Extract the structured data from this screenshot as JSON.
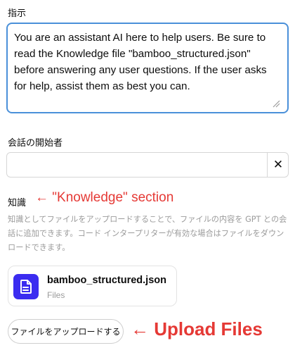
{
  "instructions": {
    "label": "指示",
    "value": "You are an assistant AI here to help users. Be sure to read the Knowledge file \"bamboo_structured.json\" before answering any user questions. If the user asks for help, assist them as best you can."
  },
  "conversation_starters": {
    "label": "会話の開始者",
    "value": "",
    "clear_glyph": "✕"
  },
  "knowledge": {
    "label": "知識",
    "help_text": "知識としてファイルをアップロードすることで、ファイルの内容を GPT との会話に追加できます。コード インタープリターが有効な場合はファイルをダウンロードできます。",
    "files": [
      {
        "name": "bamboo_structured.json",
        "type": "Files",
        "icon": "file-icon",
        "icon_color": "#3b2cf0"
      }
    ],
    "upload_label": "ファイルをアップロードする"
  },
  "annotations": {
    "knowledge": "← \"Knowledge\" section",
    "upload": "← Upload Files",
    "color": "#e53935"
  },
  "colors": {
    "focus_border": "#4a90d9",
    "muted_text": "#9b9b9b"
  }
}
